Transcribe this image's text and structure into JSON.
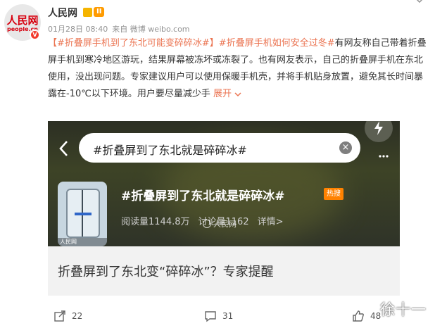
{
  "post": {
    "author": {
      "name": "人民网",
      "avatar_logo": "人民网",
      "avatar_logo_sub": "people.cn",
      "level": "II",
      "verified_mark": "V"
    },
    "date": "01月28日 08:40",
    "source": "来自 微博 weibo.com",
    "body": {
      "topic1": "【#折叠屏手机到了东北可能变碎碎冰#】",
      "topic2": "#折叠屏手机如何安全过冬#",
      "text": "有网友称自己带着折叠屏手机到寒冷地区游玩，结果屏幕被冻坏或冻裂了。也有网友表示，自己的折叠屏手机在东北使用，没出现问题。专家建议用户可以使用保暖手机壳，并将手机贴身放置，避免其长时间暴露在-10℃以下环境。用户要尽量减少手",
      "expand_label": "展开",
      "expand_icon": "chevron-down-icon"
    },
    "image_card": {
      "search_query": "#折叠屏到了东北就是碎碎冰#",
      "topic_title": "#折叠屏到了东北就是碎碎冰#",
      "hot_badge": "热搜",
      "read_count": "阅读量1144.8万",
      "discuss_count": "讨论量1162",
      "details_label": "详情>",
      "thumb_tag": "人民网",
      "watermark": "人民网"
    },
    "link_card": {
      "title": "折叠屏到了东北变“碎碎冰”？专家提醒"
    },
    "actions": {
      "share_count": "22",
      "comment_count": "31",
      "like_count": "48"
    },
    "corner_watermark": "徐十一"
  },
  "colors": {
    "brand_red": "#d7000f",
    "link_orange": "#eb7350",
    "hot_orange": "#ff8200",
    "meta_gray": "#939393"
  }
}
